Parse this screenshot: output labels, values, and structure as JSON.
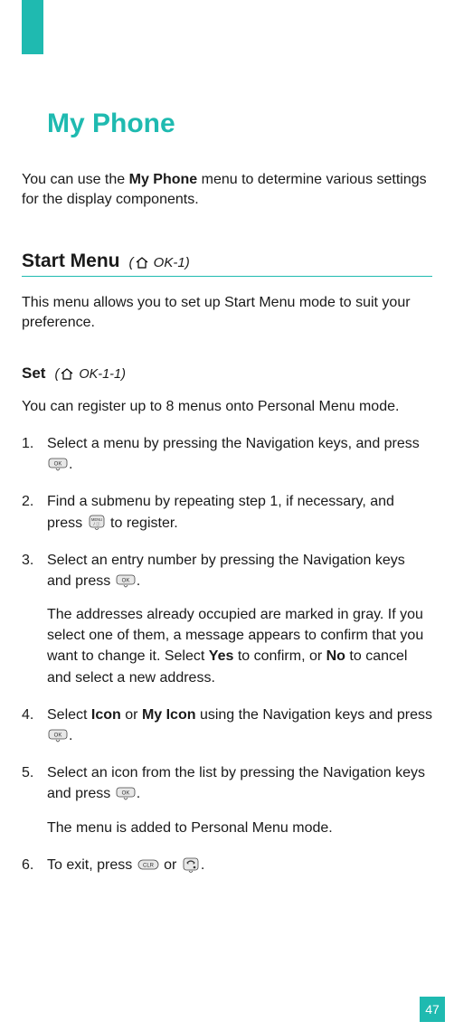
{
  "page_number": "47",
  "title": "My Phone",
  "intro_pre": "You can use the ",
  "intro_bold": "My Phone",
  "intro_post": " menu to determine various settings for the display components.",
  "section": {
    "name": "Start Menu",
    "crumb_pre": "  (",
    "crumb_post": " OK-1)",
    "desc": "This menu allows you to set up Start Menu mode to suit your preference."
  },
  "subset": {
    "name": "Set",
    "crumb_pre": "  (",
    "crumb_post": " OK-1-1)",
    "desc": "You can register up to 8 menus onto Personal Menu mode."
  },
  "steps": {
    "s1_a": "Select a menu by pressing the Navigation keys, and press ",
    "s1_b": ".",
    "s2_a": "Find a submenu by repeating step 1, if necessary, and press ",
    "s2_b": " to register.",
    "s3_a": "Select an entry number by pressing the Navigation keys and press ",
    "s3_b": ".",
    "s3_sub_a": "The addresses already occupied are marked in gray. If you select one of them, a message appears to confirm that you want to change it. Select ",
    "s3_yes": "Yes",
    "s3_mid": " to confirm, or ",
    "s3_no": "No",
    "s3_sub_b": " to cancel and select a new address.",
    "s4_a": "Select ",
    "s4_icon": "Icon",
    "s4_or": " or ",
    "s4_myicon": "My Icon",
    "s4_b": " using the Navigation keys and press ",
    "s4_c": ".",
    "s5_a": "Select an icon from the list by pressing the Navigation keys and press ",
    "s5_b": ".",
    "s5_sub": "The menu is added to Personal Menu mode.",
    "s6_a": "To exit, press ",
    "s6_or": " or ",
    "s6_b": "."
  }
}
